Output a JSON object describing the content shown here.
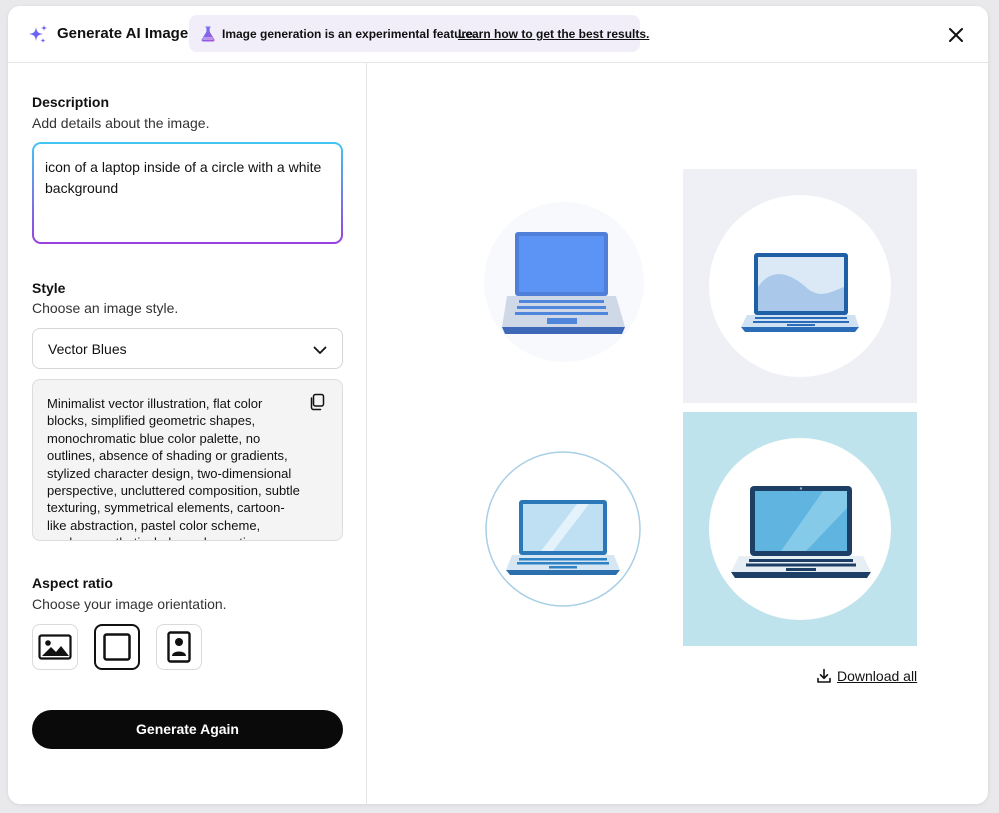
{
  "header": {
    "title": "Generate AI Image",
    "banner_message": "Image generation is an experimental feature.",
    "banner_link": "Learn how to get the best results."
  },
  "description": {
    "heading": "Description",
    "subheading": "Add details about the image.",
    "value": "icon of a laptop inside of a circle with a white background"
  },
  "style": {
    "heading": "Style",
    "subheading": "Choose an image style.",
    "selected": "Vector Blues",
    "prompt": "Minimalist vector illustration, flat color blocks, simplified geometric shapes, monochromatic blue color palette, no outlines, absence of shading or gradients, stylized character design, two-dimensional perspective, uncluttered composition, subtle texturing, symmetrical elements, cartoon-like abstraction, pastel color scheme, modern aesthetic, balanced negative space"
  },
  "aspect_ratio": {
    "heading": "Aspect ratio",
    "subheading": "Choose your image orientation.",
    "options": [
      {
        "icon": "landscape-icon",
        "selected": false
      },
      {
        "icon": "square-icon",
        "selected": true
      },
      {
        "icon": "portrait-icon",
        "selected": false
      }
    ]
  },
  "actions": {
    "generate_label": "Generate Again",
    "download_all_label": "Download all"
  },
  "images": [
    {
      "name": "generated-image-1",
      "background": "#ffffff"
    },
    {
      "name": "generated-image-2",
      "background": "#eef0f5"
    },
    {
      "name": "generated-image-3",
      "background": "#ffffff"
    },
    {
      "name": "generated-image-4",
      "background": "#bfe3ec"
    }
  ]
}
